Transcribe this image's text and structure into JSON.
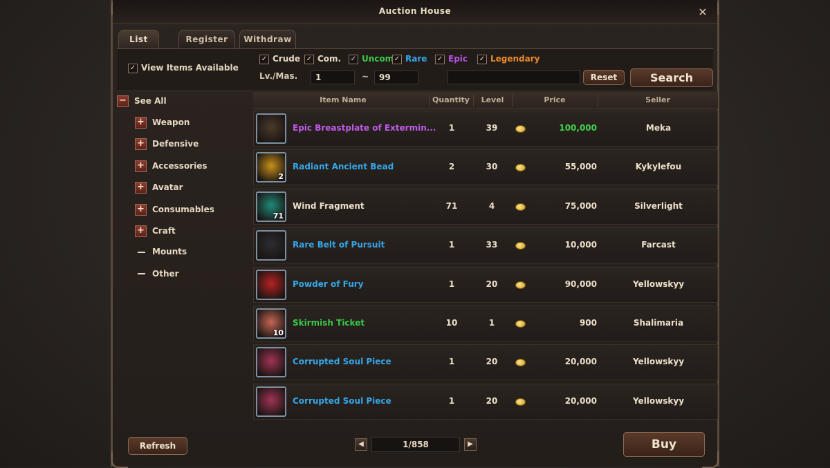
{
  "window": {
    "title": "Auction House",
    "close_glyph": "✕"
  },
  "tabs": [
    {
      "label": "List"
    },
    {
      "label": "Register"
    },
    {
      "label": "Withdraw"
    }
  ],
  "filters": {
    "view_available": {
      "label": "View Items Available",
      "checked": true
    },
    "check_glyph": "✓",
    "grades": [
      {
        "label": "Crude",
        "color": "#e6d8c1"
      },
      {
        "label": "Com.",
        "color": "#e6d8c1"
      },
      {
        "label": "Uncom",
        "color": "#39c84a"
      },
      {
        "label": "Rare",
        "color": "#35a6e8"
      },
      {
        "label": "Epic",
        "color": "#b64fe0"
      },
      {
        "label": "Legendary",
        "color": "#e88a2a"
      }
    ],
    "level_label": "Lv./Mas.",
    "level_min": "1",
    "level_tilde": "~",
    "level_max": "99",
    "search_text": "",
    "reset_label": "Reset",
    "search_label": "Search"
  },
  "sidebar": {
    "see_all": "See All",
    "expand_glyph": "+",
    "collapse_glyph": "−",
    "categories": [
      {
        "label": "Weapon",
        "expandable": true
      },
      {
        "label": "Defensive",
        "expandable": true
      },
      {
        "label": "Accessories",
        "expandable": true
      },
      {
        "label": "Avatar",
        "expandable": true
      },
      {
        "label": "Consumables",
        "expandable": true
      },
      {
        "label": "Craft",
        "expandable": true
      },
      {
        "label": "Mounts",
        "expandable": false
      },
      {
        "label": "Other",
        "expandable": false
      }
    ]
  },
  "table": {
    "headers": {
      "name": "Item Name",
      "quantity": "Quantity",
      "level": "Level",
      "price": "Price",
      "seller": "Seller"
    },
    "rows": [
      {
        "name": "Epic Breastplate of Extermin...",
        "name_color": "#c05ae6",
        "quantity": "1",
        "level": "39",
        "price": "100,000",
        "price_color": "#42d24e",
        "seller": "Meka",
        "icon": "breastplate-icon",
        "icon_bg": "#4a3a2a",
        "stack": ""
      },
      {
        "name": "Radiant Ancient Bead",
        "name_color": "#35a6e8",
        "quantity": "2",
        "level": "30",
        "price": "55,000",
        "price_color": "#ece0cb",
        "seller": "Kykylefou",
        "icon": "bead-icon",
        "icon_bg": "#c8901a",
        "stack": "2"
      },
      {
        "name": "Wind Fragment",
        "name_color": "#ece0cb",
        "quantity": "71",
        "level": "4",
        "price": "75,000",
        "price_color": "#ece0cb",
        "seller": "Silverlight",
        "icon": "fragment-icon",
        "icon_bg": "#1f8a78",
        "stack": "71"
      },
      {
        "name": "Rare Belt of Pursuit",
        "name_color": "#35a6e8",
        "quantity": "1",
        "level": "33",
        "price": "10,000",
        "price_color": "#ece0cb",
        "seller": "Farcast",
        "icon": "belt-icon",
        "icon_bg": "#2c2c33",
        "stack": ""
      },
      {
        "name": "Powder of Fury",
        "name_color": "#35a6e8",
        "quantity": "1",
        "level": "20",
        "price": "90,000",
        "price_color": "#ece0cb",
        "seller": "Yellowskyy",
        "icon": "powder-icon",
        "icon_bg": "#b52222",
        "stack": ""
      },
      {
        "name": "Skirmish Ticket",
        "name_color": "#39c84a",
        "quantity": "10",
        "level": "1",
        "price": "900",
        "price_color": "#ece0cb",
        "seller": "Shalimaria",
        "icon": "ticket-icon",
        "icon_bg": "#c56655",
        "stack": "10"
      },
      {
        "name": "Corrupted Soul Piece",
        "name_color": "#35a6e8",
        "quantity": "1",
        "level": "20",
        "price": "20,000",
        "price_color": "#ece0cb",
        "seller": "Yellowskyy",
        "icon": "soul-piece-icon",
        "icon_bg": "#a03355",
        "stack": ""
      },
      {
        "name": "Corrupted Soul Piece",
        "name_color": "#35a6e8",
        "quantity": "1",
        "level": "20",
        "price": "20,000",
        "price_color": "#ece0cb",
        "seller": "Yellowskyy",
        "icon": "soul-piece-icon",
        "icon_bg": "#a03355",
        "stack": ""
      }
    ]
  },
  "footer": {
    "refresh_label": "Refresh",
    "page_indicator": "1/858",
    "prev_glyph": "◀",
    "next_glyph": "▶",
    "buy_label": "Buy"
  }
}
